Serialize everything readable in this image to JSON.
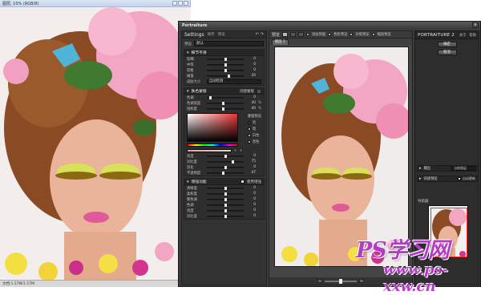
{
  "photo_window": {
    "title": "图层, 10% (RGB/8)",
    "status": "文档:1.57M/1.57M"
  },
  "main_window": {
    "title": "Portraiture"
  },
  "left_panel": {
    "title": "Settings",
    "tab1": "保存",
    "tab2": "预设",
    "preset_label": "预设",
    "preset_value": "默认",
    "smoothing": {
      "name": "细节平滑",
      "sliders": [
        {
          "label": "较细",
          "value": "0",
          "pos": 0.5
        },
        {
          "label": "中等",
          "value": "0",
          "pos": 0.5
        },
        {
          "label": "较粗",
          "value": "0",
          "pos": 0.5
        },
        {
          "label": "阈值",
          "value": "20",
          "pos": 0.6
        }
      ],
      "dropdown_label": "皮肤大小",
      "dropdown_value": "自动检测"
    },
    "skin_mask": {
      "name": "肤色蒙版",
      "option": "创建蒙版",
      "sliders": [
        {
          "label": "色调",
          "value": "0",
          "pos": 0.1
        },
        {
          "label": "色调宽度",
          "value": "40",
          "unit": "%",
          "pos": 0.45
        },
        {
          "label": "饱和度",
          "value": "40",
          "unit": "%",
          "pos": 0.45
        }
      ],
      "radio_title": "蒙版预览",
      "radios": [
        "亮",
        "暗",
        "白色",
        "黑色"
      ],
      "sliders2": [
        {
          "label": "亮度",
          "value": "0",
          "pos": 0.5
        },
        {
          "label": "对比度",
          "value": "75",
          "pos": 0.7
        },
        {
          "label": "羽化",
          "value": "0",
          "pos": 0.5
        },
        {
          "label": "不透明度",
          "value": "47",
          "pos": 0.45
        }
      ]
    },
    "enhance": {
      "name": "增强功能",
      "option": "使用增强",
      "sliders": [
        {
          "label": "清晰度",
          "value": "0",
          "pos": 0.5
        },
        {
          "label": "柔和度",
          "value": "0",
          "pos": 0.5
        },
        {
          "label": "暖色调",
          "value": "0",
          "pos": 0.5
        },
        {
          "label": "色调",
          "value": "0",
          "pos": 0.5
        },
        {
          "label": "亮度",
          "value": "0",
          "pos": 0.5
        },
        {
          "label": "对比度",
          "value": "0",
          "pos": 0.5
        }
      ]
    }
  },
  "center": {
    "label": "预览",
    "opt1": "添加到面",
    "opt2": "色阶预览",
    "opt3": "对照预览",
    "opt4": "缩放预览",
    "tab": "图层 1"
  },
  "right_panel": {
    "brand": "PORTRAITURE 2",
    "link1": "关于",
    "link2": "帮助",
    "ok_button": "确定",
    "cancel_button": "取消",
    "output_label": "输出",
    "output_value": "当前图层",
    "quick_label": "快速预览",
    "quick_option": "自动更新",
    "navigator": "导航器"
  },
  "watermark": {
    "line1": "PS学习网",
    "line2": "www.ps-xxw.cn"
  }
}
